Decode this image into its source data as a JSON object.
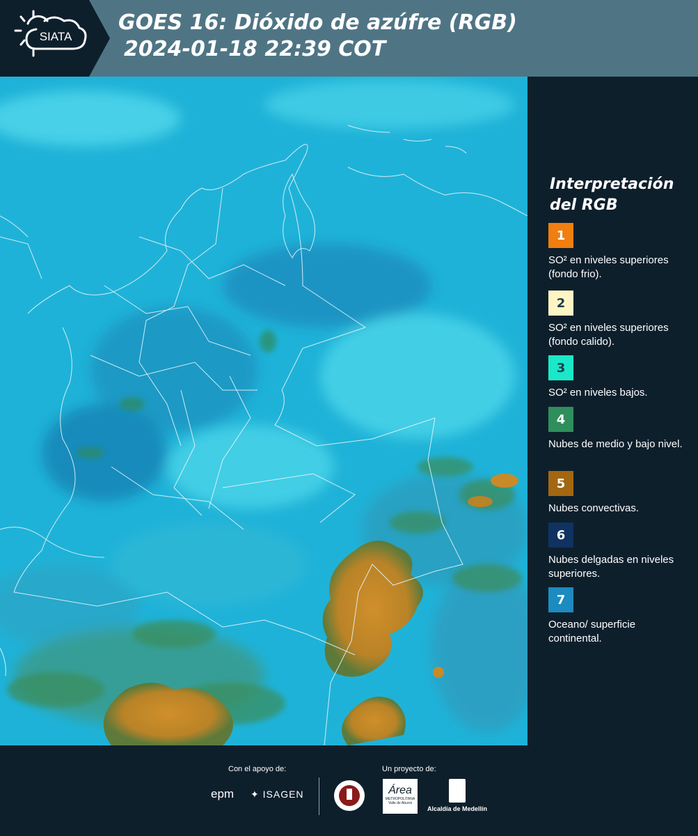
{
  "header": {
    "brand": "SIATA",
    "title_line1": "GOES 16: Dióxido de azúfre (RGB)",
    "title_line2": "2024-01-18 22:39 COT",
    "background": "#4f7585"
  },
  "legend": {
    "title_line1": "Interpretación",
    "title_line2": "del RGB",
    "items": [
      {
        "number": "1",
        "color": "#f07f10",
        "text_color": "#ffffff",
        "label": "SO² en niveles superiores (fondo frio)."
      },
      {
        "number": "2",
        "color": "#fdf6c4",
        "text_color": "#1f3d4d",
        "label": "SO² en niveles superiores (fondo calido)."
      },
      {
        "number": "3",
        "color": "#1ae8c9",
        "text_color": "#1f3d4d",
        "label": "SO² en niveles bajos."
      },
      {
        "number": "4",
        "color": "#2f8f5c",
        "text_color": "#ffffff",
        "label": "Nubes de medio y bajo nivel."
      },
      {
        "number": "5",
        "color": "#a26710",
        "text_color": "#ffffff",
        "label": "Nubes convectivas."
      },
      {
        "number": "6",
        "color": "#0f3260",
        "text_color": "#ffffff",
        "label": "Nubes delgadas en niveles superiores."
      },
      {
        "number": "7",
        "color": "#1b8bc0",
        "text_color": "#ffffff",
        "label": "Oceano/ superficie continental."
      }
    ]
  },
  "footer": {
    "support_label": "Con el apoyo de:",
    "project_label": "Un proyecto de:",
    "sponsor_1": "epm",
    "sponsor_2": "ISAGEN",
    "partner_1": "Área",
    "partner_1_sub": "METROPOLITANA Valle de Aburrá",
    "partner_2": "Alcaldía de Medellín"
  },
  "map_colors": {
    "base": "#1fb2d8",
    "light": "#4fd6ea",
    "dark": "#137fb0",
    "convective": "#c98a28",
    "vegetation": "#2f8a5c"
  }
}
